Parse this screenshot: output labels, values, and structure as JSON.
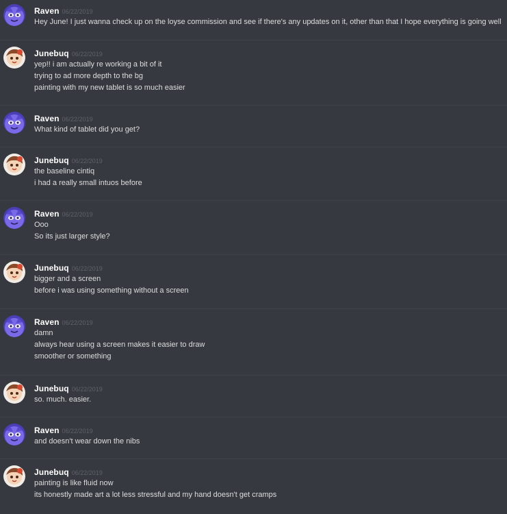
{
  "messages": [
    {
      "author": "Raven",
      "avatar": "raven-avatar",
      "timestamp": "06/22/2019",
      "lines": [
        "Hey June!  I just wanna check up on the loyse commission and see if there's any updates on it, other than that I hope everything is going well"
      ]
    },
    {
      "author": "Junebuq",
      "avatar": "junebuq-avatar",
      "timestamp": "06/22/2019",
      "lines": [
        "yep!! i am actually re working a bit of it",
        "trying to ad more depth to the bg",
        "painting with my new tablet is so much easier"
      ]
    },
    {
      "author": "Raven",
      "avatar": "raven-avatar",
      "timestamp": "06/22/2019",
      "lines": [
        "What kind of tablet did you get?"
      ]
    },
    {
      "author": "Junebuq",
      "avatar": "junebuq-avatar",
      "timestamp": "06/22/2019",
      "lines": [
        "the baseline cintiq",
        "i had a really small intuos before"
      ]
    },
    {
      "author": "Raven",
      "avatar": "raven-avatar",
      "timestamp": "06/22/2019",
      "lines": [
        "Ooo",
        "So its just larger style?"
      ]
    },
    {
      "author": "Junebuq",
      "avatar": "junebuq-avatar",
      "timestamp": "06/22/2019",
      "lines": [
        "bigger and a screen",
        "before i was using something without a screen"
      ]
    },
    {
      "author": "Raven",
      "avatar": "raven-avatar",
      "timestamp": "06/22/2019",
      "lines": [
        "damn",
        "always hear using a screen makes it easier to draw",
        "smoother or something"
      ]
    },
    {
      "author": "Junebuq",
      "avatar": "junebuq-avatar",
      "timestamp": "06/22/2019",
      "lines": [
        "so. much. easier."
      ]
    },
    {
      "author": "Raven",
      "avatar": "raven-avatar",
      "timestamp": "06/22/2019",
      "lines": [
        "and doesn't wear down the nibs"
      ]
    },
    {
      "author": "Junebuq",
      "avatar": "junebuq-avatar",
      "timestamp": "06/22/2019",
      "lines": [
        "painting is like fluid now",
        "its honestly made art a lot less stressful and my hand doesn't get cramps"
      ]
    }
  ],
  "colors": {
    "background": "#36393f",
    "username": "#ffffff",
    "timestamp": "#5f6268",
    "text": "#dcddde",
    "divider": "#3f4248"
  }
}
